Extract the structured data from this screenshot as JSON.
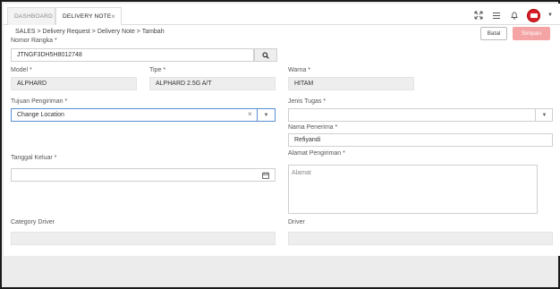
{
  "tabs": [
    {
      "label": "DASHBOARD"
    },
    {
      "label": "DELIVERY NOTE",
      "close": "×"
    }
  ],
  "header_icons": [
    "expand-icon",
    "menu-icon",
    "bell-icon",
    "avatar",
    "chevron-down-icon"
  ],
  "breadcrumb": "SALES > Delivery Request > Delivery Note > Tambah",
  "actions": {
    "cancel": "Batal",
    "save": "Simpan"
  },
  "form": {
    "nomor_rangka": {
      "label": "Nomor Rangka",
      "required": "*",
      "value": "JTNGF3DH5H8012748"
    },
    "model": {
      "label": "Model",
      "required": "*",
      "value": "ALPHARD"
    },
    "tipe": {
      "label": "Tipe",
      "required": "*",
      "value": "ALPHARD 2.5G A/T"
    },
    "warna": {
      "label": "Warna",
      "required": "*",
      "value": "HITAM"
    },
    "tujuan_pengiriman": {
      "label": "Tujuan Pengiriman",
      "required": "*",
      "value": "Change Location"
    },
    "jenis_tugas": {
      "label": "Jenis Tugas",
      "required": "*",
      "value": ""
    },
    "nama_penerima": {
      "label": "Nama Penerima",
      "required": "*",
      "value": "Refiyandi"
    },
    "tanggal_keluar": {
      "label": "Tanggal Keluar",
      "required": "*",
      "value": ""
    },
    "alamat_pengiriman": {
      "label": "Alamat Pengiriman",
      "required": "*",
      "placeholder": "Alamat"
    },
    "category_driver": {
      "label": "Category Driver",
      "value": ""
    },
    "driver": {
      "label": "Driver",
      "value": ""
    }
  },
  "colors": {
    "accent": "#d81e2a",
    "save_disabled": "#f4a4a4",
    "focus_border": "#5a8fd0"
  }
}
